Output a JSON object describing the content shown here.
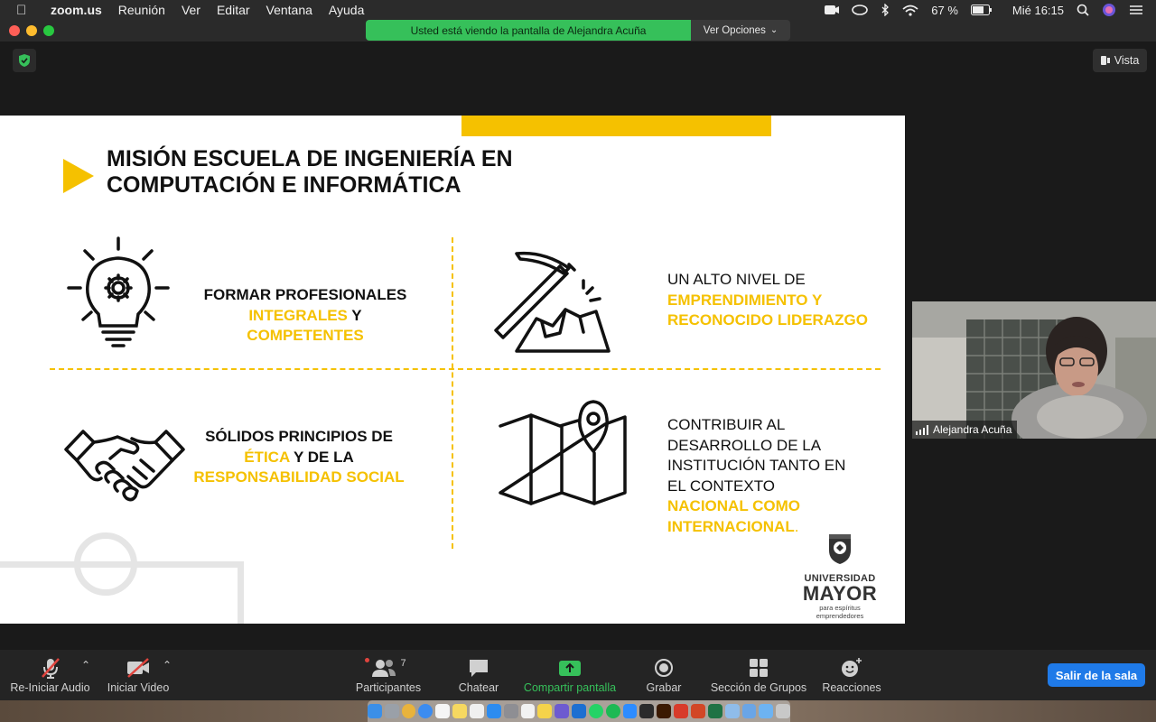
{
  "menubar": {
    "app": "zoom.us",
    "items": [
      "Reunión",
      "Ver",
      "Editar",
      "Ventana",
      "Ayuda"
    ],
    "battery": "67 %",
    "clock": "Mié 16:15"
  },
  "share_banner": {
    "message": "Usted está viendo la pantalla de Alejandra Acuña",
    "options_label": "Ver Opciones"
  },
  "view_button": "Vista",
  "slide": {
    "title_line1": "MISIÓN ESCUELA DE INGENIERÍA EN",
    "title_line2": "COMPUTACIÓN E INFORMÁTICA",
    "q1": {
      "l1": "FORMAR PROFESIONALES",
      "l2a": "INTEGRALES",
      "l2b": " Y",
      "l3": "COMPETENTES"
    },
    "q2": {
      "l1": "UN ALTO NIVEL DE",
      "l2": "EMPRENDIMIENTO Y",
      "l3": "RECONOCIDO LIDERAZGO"
    },
    "q3": {
      "l1": "SÓLIDOS PRINCIPIOS DE",
      "l2a": "ÉTICA",
      "l2b": " Y DE LA",
      "l3": "RESPONSABILIDAD SOCIAL"
    },
    "q4": {
      "l1": "CONTRIBUIR AL",
      "l2": "DESARROLLO DE LA",
      "l3": "INSTITUCIÓN TANTO EN",
      "l4": "EL CONTEXTO",
      "l5": "NACIONAL COMO",
      "l6": "INTERNACIONAL",
      "l6b": "."
    },
    "logo": {
      "uni": "UNIVERSIDAD",
      "mayor": "MAYOR",
      "sub": "para espíritus emprendedores"
    }
  },
  "participant_video": {
    "name": "Alejandra Acuña"
  },
  "toolbar": {
    "audio": "Re-Iniciar Audio",
    "video": "Iniciar Video",
    "participants": "Participantes",
    "participants_count": "7",
    "chat": "Chatear",
    "share": "Compartir pantalla",
    "record": "Grabar",
    "breakout": "Sección de Grupos",
    "reactions": "Reacciones",
    "leave": "Salir de la sala"
  },
  "colors": {
    "accent_yellow": "#f5c100",
    "share_green": "#36c05a",
    "leave_blue": "#1f7ae8"
  }
}
